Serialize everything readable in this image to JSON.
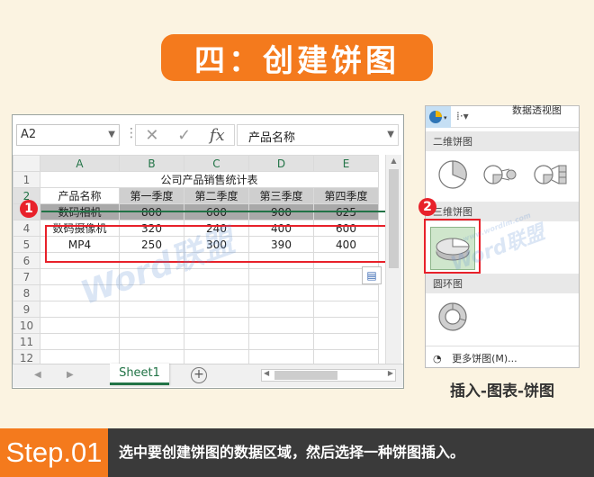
{
  "banner": {
    "title": "四：创建饼图"
  },
  "excel": {
    "name_box": "A2",
    "formula_value": "产品名称",
    "columns": [
      "A",
      "B",
      "C",
      "D",
      "E"
    ],
    "rows": [
      "1",
      "2",
      "3",
      "4",
      "5",
      "6",
      "7",
      "8",
      "9",
      "10",
      "11",
      "12"
    ],
    "table_title": "公司产品销售统计表",
    "headers": [
      "产品名称",
      "第一季度",
      "第二季度",
      "第三季度",
      "第四季度"
    ],
    "data": [
      [
        "数码相机",
        "800",
        "600",
        "900",
        "625"
      ],
      [
        "数码摄像机",
        "320",
        "240",
        "400",
        "600"
      ],
      [
        "MP4",
        "250",
        "300",
        "390",
        "400"
      ]
    ],
    "sheet_tab": "Sheet1",
    "badge1": "1"
  },
  "panel": {
    "top_text": "数据透视图",
    "section_2d": "二维饼图",
    "section_3d": "三维饼图",
    "section_donut": "圆环图",
    "more_pie": "更多饼图(M)...",
    "badge2": "2"
  },
  "caption": "插入-图表-饼图",
  "watermarks": [
    "Word联盟",
    "Word联盟",
    "www.wordlm.com"
  ],
  "footer": {
    "step": "Step.01",
    "instruction": "选中要创建饼图的数据区域，然后选择一种饼图插入。"
  },
  "colors": {
    "accent": "#f47a1d",
    "excel_green": "#217346",
    "highlight_red": "#e8212a"
  }
}
